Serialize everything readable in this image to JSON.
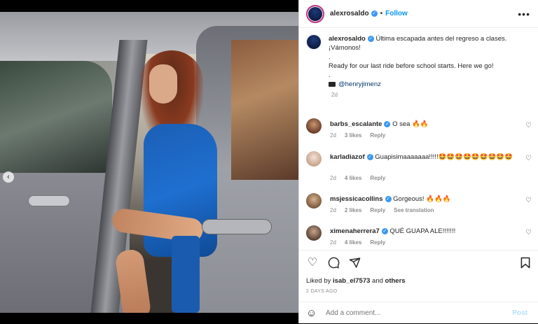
{
  "header": {
    "username": "alexrosaldo",
    "separator": "•",
    "follow_label": "Follow",
    "more_icon": "more-horizontal-icon"
  },
  "caption": {
    "username": "alexrosaldo",
    "line1": "Última escapada antes del regreso a clases. ¡Vámonos!",
    "line2": ".",
    "line3": "Ready for our last ride before school starts. Here we go!",
    "line4": ".",
    "mention": "@henryjimenz",
    "time": "2d"
  },
  "comments": [
    {
      "username": "barbs_escalante",
      "text": "O sea 🔥🔥",
      "time": "2d",
      "likes": "3 likes",
      "reply": "Reply",
      "extra": ""
    },
    {
      "username": "karladiazof",
      "text": "Guapisimaaaaaaa!!!!!🤩🤩🤩🤩🤩🤩🤩🤩🤩",
      "time": "2d",
      "likes": "4 likes",
      "reply": "Reply",
      "extra": ""
    },
    {
      "username": "msjessicacollins",
      "text": "Gorgeous! 🔥🔥🔥",
      "time": "2d",
      "likes": "2 likes",
      "reply": "Reply",
      "extra": "See translation"
    },
    {
      "username": "ximenaherrera7",
      "text": "QUÉ GUAPA ALE!!!!!!!",
      "time": "2d",
      "likes": "4 likes",
      "reply": "Reply",
      "extra": ""
    }
  ],
  "actions": {
    "like_icon": "heart-icon",
    "comment_icon": "comment-icon",
    "share_icon": "send-icon",
    "save_icon": "bookmark-icon",
    "liked_prefix": "Liked by",
    "liked_user": "isab_el7573",
    "liked_and": "and",
    "liked_others": "others",
    "posted_ago": "2 DAYS AGO"
  },
  "add_comment": {
    "placeholder": "Add a comment...",
    "post_label": "Post"
  },
  "colors": {
    "accent": "#0095f6",
    "verified": "#3897f0",
    "post_disabled": "#b2dffc"
  }
}
